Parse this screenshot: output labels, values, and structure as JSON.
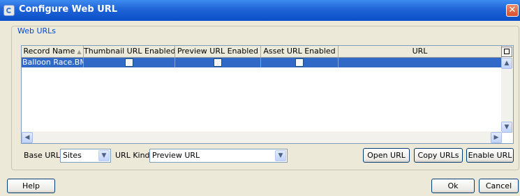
{
  "window": {
    "title": "Configure Web URL",
    "close_glyph": "✕"
  },
  "group": {
    "legend": "Web URLs"
  },
  "table": {
    "columns": [
      "Record Name",
      "Thumbnail URL Enabled",
      "Preview URL Enabled",
      "Asset URL Enabled",
      "URL"
    ],
    "sort_indicator": "▲",
    "rows": [
      {
        "record_name": "Balloon Race.BMP",
        "thumbnail_enabled": false,
        "preview_enabled": false,
        "asset_enabled": false,
        "url": ""
      }
    ],
    "selected_row_color": "#3169c6"
  },
  "filters": {
    "base_url_label": "Base URL:",
    "base_url_value": "Sites",
    "url_kind_label": "URL Kind:",
    "url_kind_value": "Preview URL"
  },
  "actions": {
    "open_url": "Open URL",
    "copy_urls": "Copy URLs",
    "enable_url": "Enable URL"
  },
  "footer": {
    "help": "Help",
    "ok": "Ok",
    "cancel": "Cancel"
  },
  "glyphs": {
    "up": "▲",
    "down": "▼",
    "left": "◀",
    "right": "▶"
  }
}
